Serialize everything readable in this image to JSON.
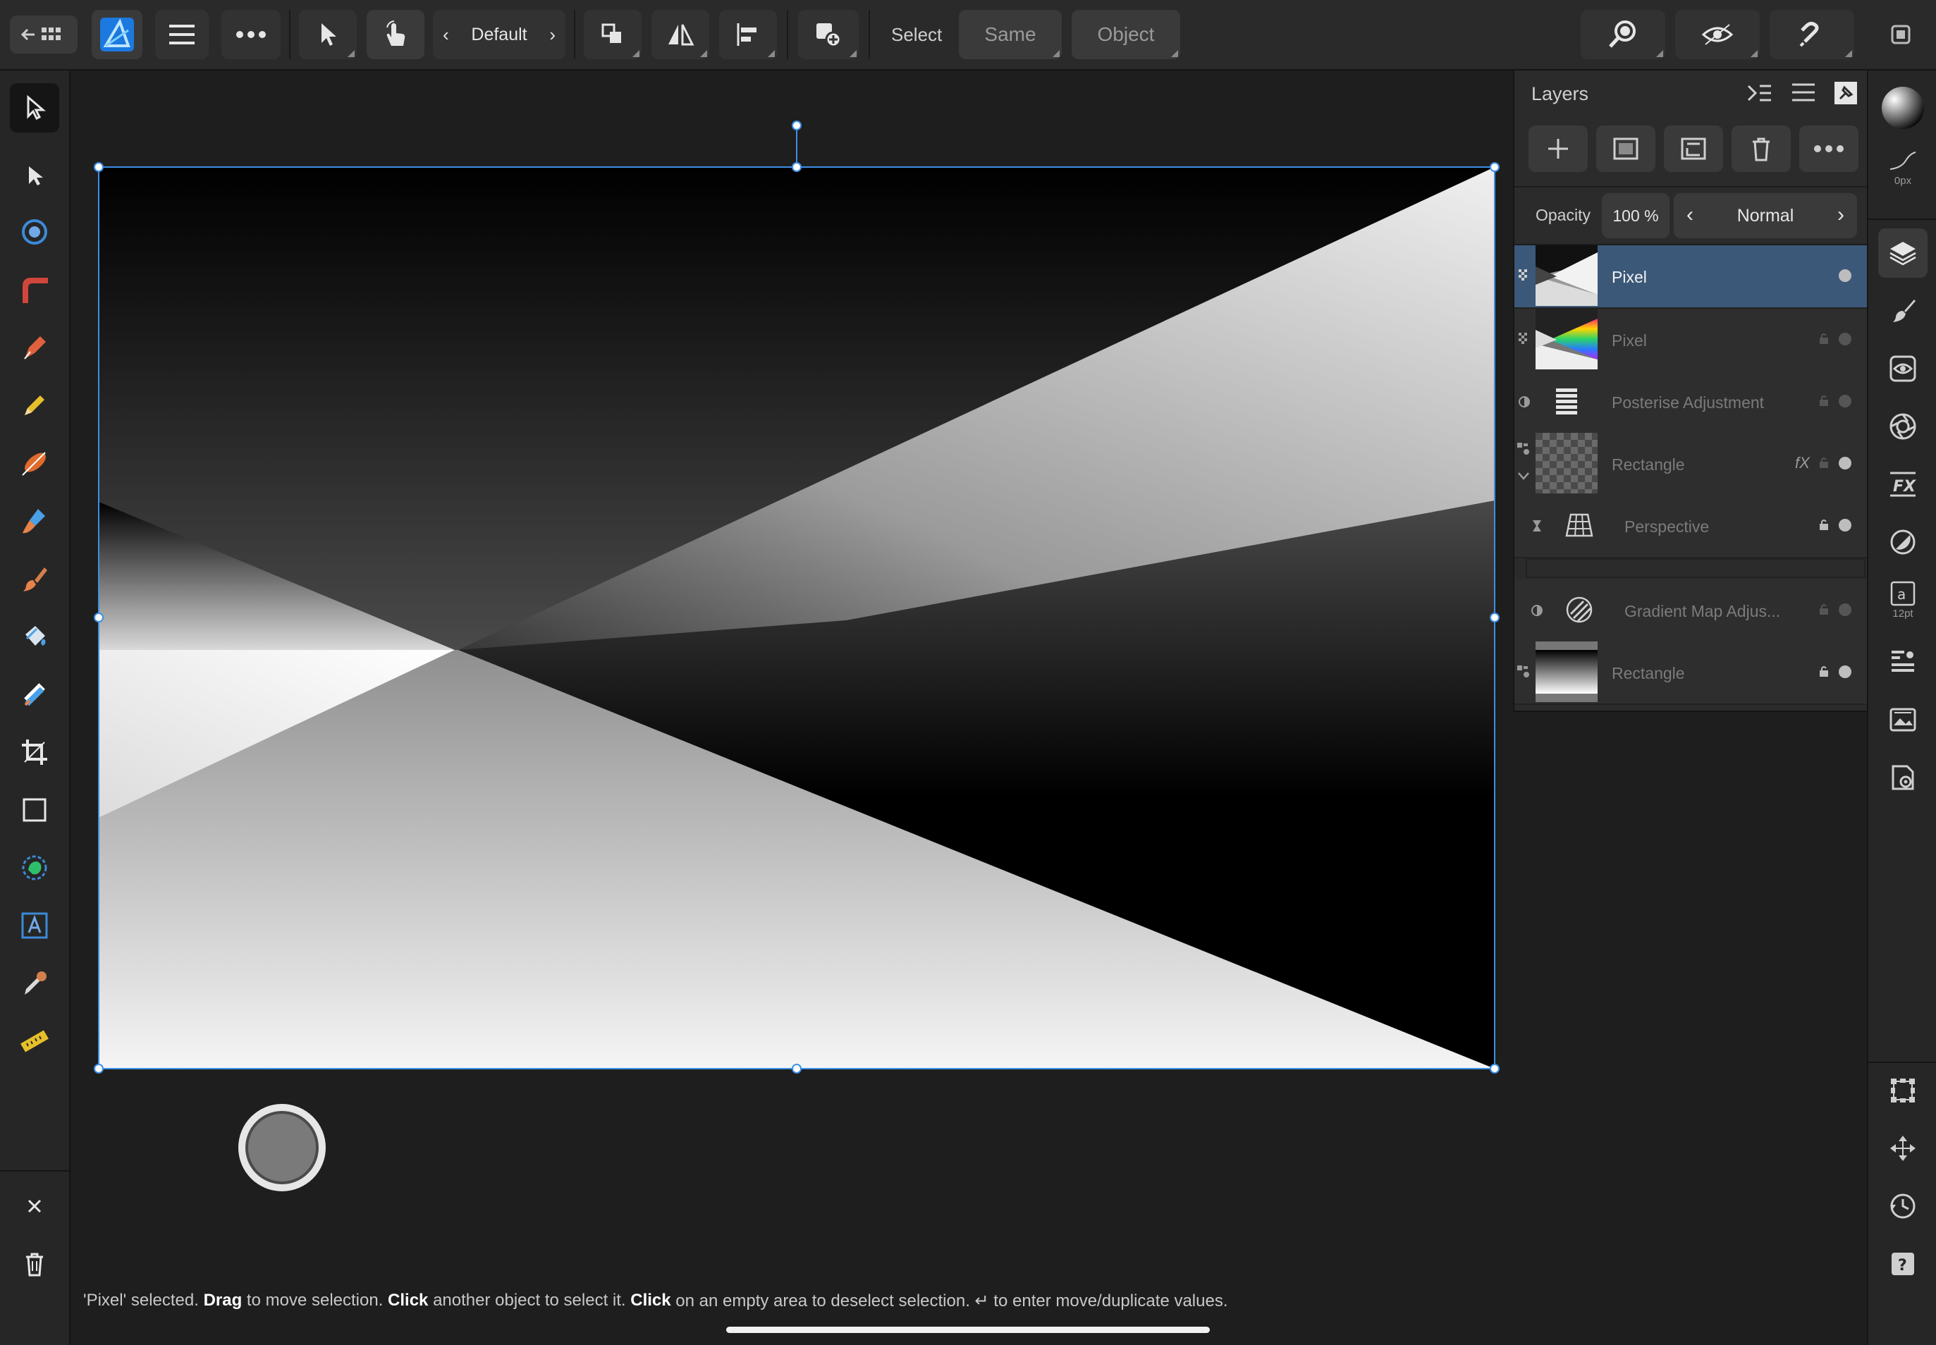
{
  "toolbar": {
    "persona_name": "Default",
    "select_label": "Select",
    "same_label": "Same",
    "object_label": "Object"
  },
  "left_tools": [
    {
      "icon": "move-tool-icon"
    },
    {
      "icon": "node-tool-icon"
    },
    {
      "icon": "point-transform-icon"
    },
    {
      "icon": "corner-tool-icon"
    },
    {
      "icon": "pen-tool-icon"
    },
    {
      "icon": "pencil-tool-icon"
    },
    {
      "icon": "vector-brush-icon"
    },
    {
      "icon": "fill-tool-icon"
    },
    {
      "icon": "pixel-brush-icon"
    },
    {
      "icon": "paint-bucket-icon"
    },
    {
      "icon": "gradient-tool-icon"
    },
    {
      "icon": "crop-tool-icon"
    },
    {
      "icon": "rectangle-tool-icon"
    },
    {
      "icon": "shape-tool-icon"
    },
    {
      "icon": "text-tool-icon"
    },
    {
      "icon": "color-picker-icon"
    },
    {
      "icon": "ruler-tool-icon"
    }
  ],
  "layers_panel": {
    "title": "Layers",
    "opacity_label": "Opacity",
    "opacity_value": "100 %",
    "blend_mode": "Normal",
    "layers": [
      {
        "name": "Pixel",
        "selected": true
      },
      {
        "name": "Pixel",
        "selected": false
      },
      {
        "name": "Posterise Adjustment",
        "selected": false
      },
      {
        "name": "Rectangle",
        "selected": false,
        "badge": "fX"
      },
      {
        "name": "Perspective",
        "selected": false,
        "child": true
      },
      {
        "name": "Gradient Map Adjus...",
        "selected": false,
        "child": true
      },
      {
        "name": "Rectangle",
        "selected": false
      }
    ]
  },
  "right_panel": {
    "stroke_width": "0px",
    "font_size": "12pt"
  },
  "status": {
    "p1": "'Pixel' selected. ",
    "b1": "Drag",
    "p2": " to move selection. ",
    "b2": "Click",
    "p3": " another object to select it. ",
    "b3": "Click",
    "p4": " on an empty area to deselect selection. ↵ to enter move/duplicate values."
  },
  "colors": {
    "accent": "#2f8cf0",
    "selection_row": "#3b5878",
    "background": "#1e1e1e"
  }
}
